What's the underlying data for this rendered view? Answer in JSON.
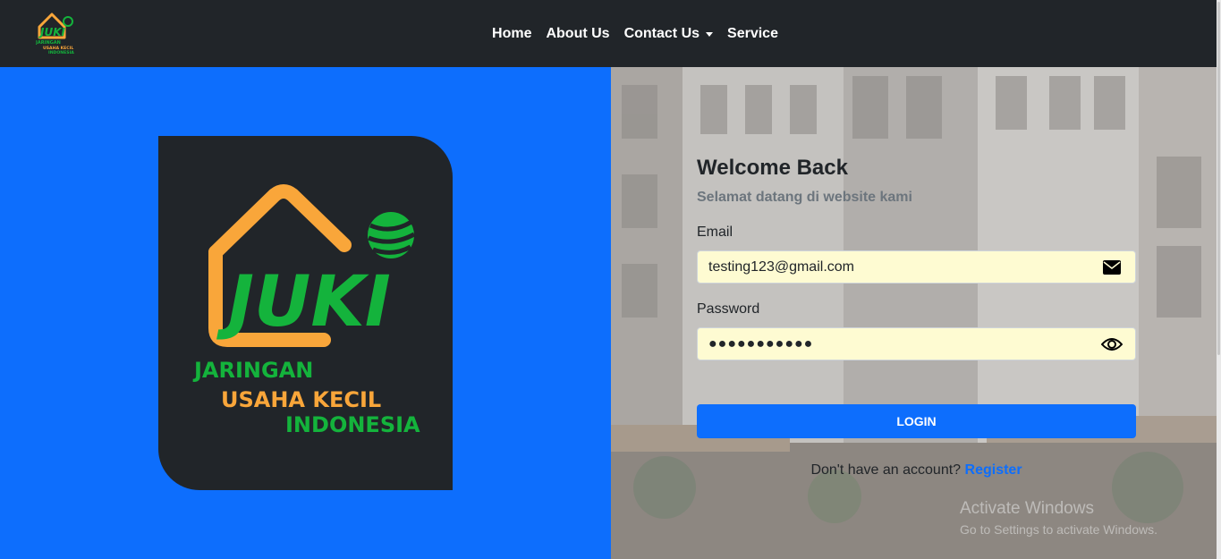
{
  "brand": {
    "logo_text": "JUKI",
    "tagline_line1": "JARINGAN",
    "tagline_line2": "USAHA KECIL",
    "tagline_line3": "INDONESIA"
  },
  "nav": {
    "items": [
      {
        "label": "Home"
      },
      {
        "label": "About Us"
      },
      {
        "label": "Contact Us"
      },
      {
        "label": "Service"
      }
    ]
  },
  "login": {
    "title": "Welcome Back",
    "subtitle": "Selamat datang di website kami",
    "email_label": "Email",
    "email_value": "testing123@gmail.com",
    "password_label": "Password",
    "password_value": "●●●●●●●●●●●",
    "button_label": "LOGIN",
    "register_prompt": "Don't have an account?",
    "register_link": "Register"
  },
  "watermark": {
    "line1": "Activate Windows",
    "line2": "Go to Settings to activate Windows."
  },
  "colors": {
    "navbar": "#212529",
    "primary": "#0d6efd",
    "logo_orange": "#f9a63a",
    "logo_green": "#14b33c",
    "input_bg": "#fefbd2"
  },
  "icons": {
    "email": "envelope-icon",
    "password": "eye-icon",
    "dropdown": "caret-down-icon"
  }
}
